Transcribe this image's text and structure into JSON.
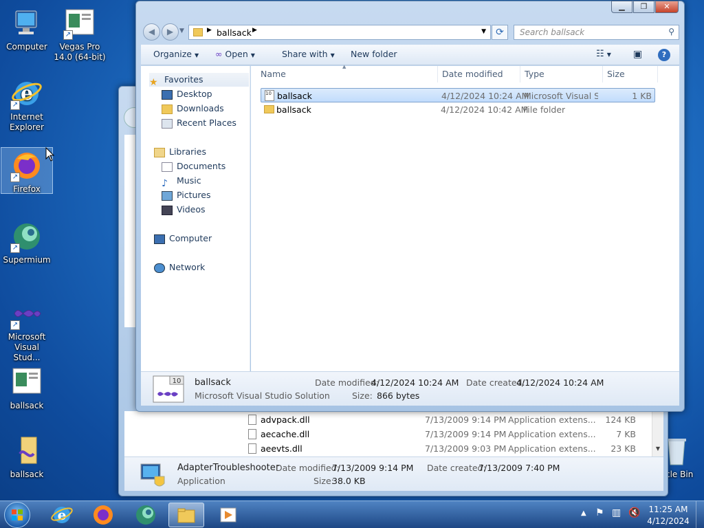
{
  "desktop": {
    "icons": [
      {
        "label": "Computer"
      },
      {
        "label": "Vegas Pro 14.0 (64-bit)"
      },
      {
        "label": "Internet Explorer"
      },
      {
        "label": "Firefox"
      },
      {
        "label": "Supermium"
      },
      {
        "label": "Microsoft Visual Stud..."
      },
      {
        "label": "ballsack"
      },
      {
        "label": "ballsack"
      },
      {
        "label": "cle Bin"
      }
    ]
  },
  "explorer": {
    "address": {
      "crumb": "ballsack",
      "search_placeholder": "Search ballsack"
    },
    "toolbar": {
      "organize": "Organize",
      "open": "Open",
      "share": "Share with",
      "newfolder": "New folder"
    },
    "nav": {
      "favorites": "Favorites",
      "desktop": "Desktop",
      "downloads": "Downloads",
      "recent": "Recent Places",
      "libraries": "Libraries",
      "documents": "Documents",
      "music": "Music",
      "pictures": "Pictures",
      "videos": "Videos",
      "computer": "Computer",
      "network": "Network"
    },
    "columns": {
      "name": "Name",
      "date": "Date modified",
      "type": "Type",
      "size": "Size"
    },
    "files": [
      {
        "name": "ballsack",
        "date": "4/12/2024 10:24 AM",
        "type": "Microsoft Visual S...",
        "size": "1 KB"
      },
      {
        "name": "ballsack",
        "date": "4/12/2024 10:42 AM",
        "type": "File folder",
        "size": ""
      }
    ],
    "details": {
      "name": "ballsack",
      "kind": "Microsoft Visual Studio Solution",
      "mod_label": "Date modified:",
      "mod": "4/12/2024 10:24 AM",
      "created_label": "Date created:",
      "created": "4/12/2024 10:24 AM",
      "size_label": "Size:",
      "size": "866 bytes"
    }
  },
  "back_window": {
    "files": [
      {
        "name": "advpack.dll",
        "date": "7/13/2009 9:14 PM",
        "type": "Application extens...",
        "size": "124 KB"
      },
      {
        "name": "aecache.dll",
        "date": "7/13/2009 9:14 PM",
        "type": "Application extens...",
        "size": "7 KB"
      },
      {
        "name": "aeevts.dll",
        "date": "7/13/2009 9:03 PM",
        "type": "Application extens...",
        "size": "23 KB"
      }
    ],
    "details": {
      "name": "AdapterTroubleshooter",
      "kind": "Application",
      "mod_label": "Date modified:",
      "mod": "7/13/2009 9:14 PM",
      "created_label": "Date created:",
      "created": "7/13/2009 7:40 PM",
      "size_label": "Size:",
      "size": "38.0 KB"
    }
  },
  "tray": {
    "time": "11:25 AM",
    "date": "4/12/2024"
  }
}
